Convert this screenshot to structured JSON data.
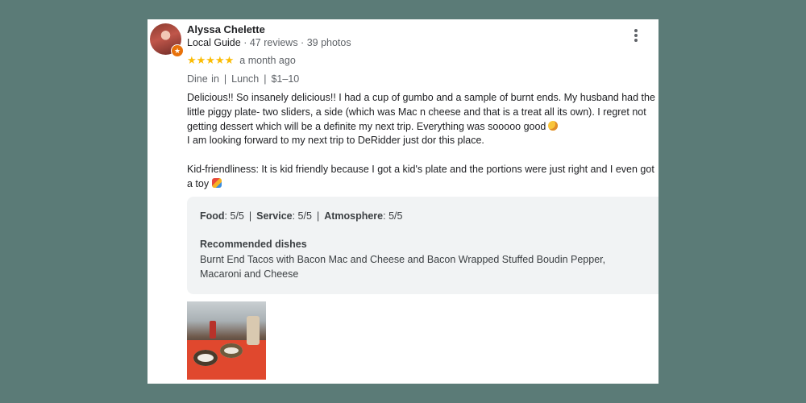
{
  "reviewer": {
    "name": "Alyssa Chelette",
    "guide_label": "Local Guide",
    "reviews": "47 reviews",
    "photos": "39 photos",
    "meta_sep": " · "
  },
  "rating": {
    "stars": "★★★★★",
    "value": 5,
    "max": 5,
    "date": "a month ago"
  },
  "tags": [
    "Dine in",
    "Lunch",
    "$1–10"
  ],
  "review": {
    "paragraph1": "Delicious!! So insanely delicious!! I had a cup of gumbo and a sample of burnt ends. My husband had the little piggy plate- two sliders, a side (which was Mac n cheese and that is a treat all its own). I regret not getting dessert which will be a definite my next trip. Everything was sooooo good",
    "paragraph2": "I am looking forward to my next trip to DeRidder just dor this place.",
    "paragraph3": "Kid-friendliness: It is kid friendly because I got a kid's plate and the portions were just right and I even got a toy"
  },
  "scores": [
    {
      "label": "Food",
      "value": ": 5/5"
    },
    {
      "label": "Service",
      "value": ": 5/5"
    },
    {
      "label": "Atmosphere",
      "value": ": 5/5"
    }
  ],
  "recommended": {
    "title": "Recommended dishes",
    "text": "Burnt End Tacos with Bacon Mac and Cheese and Bacon Wrapped Stuffed Boudin Pepper, Macaroni and Cheese"
  },
  "colors": {
    "background": "#5b7b77",
    "star": "#fbbc04",
    "badge": "#e8710a",
    "panel": "#f1f3f4"
  },
  "icons": {
    "menu": "more-vert-icon",
    "badge": "local-guide-star-icon"
  }
}
